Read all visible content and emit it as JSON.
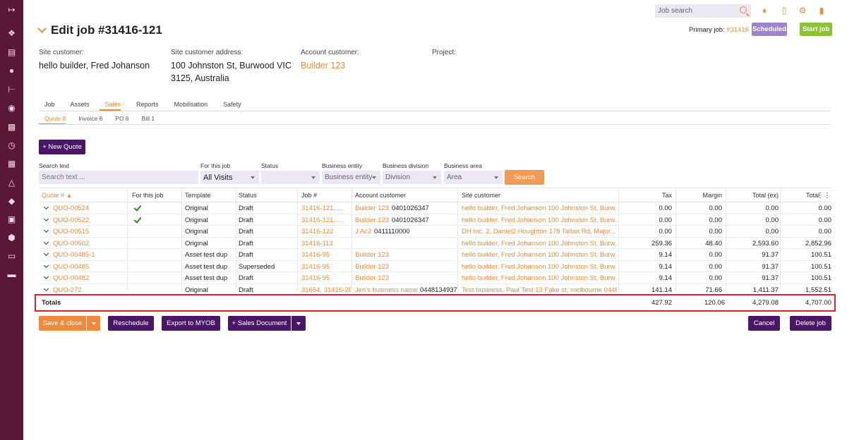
{
  "sidebar": {
    "icons": [
      "expand-icon",
      "tags-icon",
      "document-icon",
      "person-icon",
      "hierarchy-icon",
      "location-pin-icon",
      "chart-icon",
      "clock-icon",
      "calendar-icon",
      "cube-icon",
      "tag-icon",
      "list-box-icon",
      "shield-icon",
      "book-icon",
      "inbox-icon"
    ]
  },
  "topbar": {
    "search_placeholder": "Job search"
  },
  "header": {
    "title": "Edit job #31416-121",
    "primary_job_label": "Primary job:",
    "primary_job_value": "#31416",
    "status_badge": "Scheduled",
    "start_button": "Start job"
  },
  "info": {
    "site_customer_label": "Site customer:",
    "site_customer_value": "hello builder, Fred Johanson",
    "site_address_label": "Site customer address:",
    "site_address_line1": "100 Johnston St, Burwood VIC",
    "site_address_line2": "3125, Australia",
    "account_customer_label": "Account customer:",
    "account_customer_value": "Builder 123",
    "project_label": "Project:"
  },
  "tabs": [
    "Job",
    "Assets",
    "Sales",
    "Reports",
    "Mobilisation",
    "Safety"
  ],
  "active_tab": "Sales",
  "subtabs": [
    "Quote 8",
    "Invoice 6",
    "PO 6",
    "Bill 1"
  ],
  "new_quote_button": "+ New Quote",
  "filters": {
    "search_text_label": "Search text",
    "search_text_placeholder": "Search text ...",
    "for_this_job_label": "For this job",
    "for_this_job_value": "All Visits",
    "status_label": "Status",
    "status_value": "",
    "business_entity_label": "Business entity",
    "business_entity_value": "Business entity",
    "business_division_label": "Business division",
    "business_division_value": "Division",
    "business_area_label": "Business area",
    "business_area_value": "Area",
    "search_button": "Search"
  },
  "table": {
    "columns": [
      "Quote #",
      "For this job",
      "Template",
      "Status",
      "Job #",
      "Account customer",
      "Site customer",
      "Tax",
      "Margin",
      "Total (ex)",
      "Total"
    ],
    "rows": [
      {
        "quote": "QUO-00524",
        "for_job": true,
        "template": "Original",
        "status": "Draft",
        "job": "31416-121, ...",
        "account": "Builder 123",
        "account_phone": "0401026347",
        "site": "hello builder, Fred Johanson 100 Johnston St, Burw...",
        "tax": "0.00",
        "margin": "0.00",
        "total_ex": "0.00",
        "total": "0.00"
      },
      {
        "quote": "QUO-00522",
        "for_job": true,
        "template": "Original",
        "status": "Draft",
        "job": "31416-121, ...",
        "account": "Builder 123",
        "account_phone": "0401026347",
        "site": "hello builder, Fred Johanson 100 Johnston St, Burw...",
        "tax": "0.00",
        "margin": "0.00",
        "total_ex": "0.00",
        "total": "0.00"
      },
      {
        "quote": "QUO-00515",
        "for_job": false,
        "template": "Original",
        "status": "Draft",
        "job": "31416-122",
        "account": "J Ac2",
        "account_phone": "0411110000",
        "site": "DH Inc. 2, Daniel2 Houghton 178 Talbot Rd, Major...",
        "tax": "0.00",
        "margin": "0.00",
        "total_ex": "0.00",
        "total": "0.00"
      },
      {
        "quote": "QUO-00502",
        "for_job": false,
        "template": "Original",
        "status": "Draft",
        "job": "31416-113",
        "account": "",
        "account_phone": "",
        "site": "hello builder, Fred Johanson 100 Johnston St, Burw...",
        "tax": "259.36",
        "margin": "48.40",
        "total_ex": "2,593.60",
        "total": "2,852.96"
      },
      {
        "quote": "QUO-00485-1",
        "for_job": false,
        "template": "Asset test dup",
        "status": "Draft",
        "job": "31416-95",
        "account": "Builder 123",
        "account_phone": "",
        "site": "hello builder, Fred Johanson 100 Johnston St, Burw...",
        "tax": "9.14",
        "margin": "0.00",
        "total_ex": "91.37",
        "total": "100.51"
      },
      {
        "quote": "QUO-00485",
        "for_job": false,
        "template": "Asset test dup",
        "status": "Superseded",
        "job": "31416-95",
        "account": "Builder 123",
        "account_phone": "",
        "site": "hello builder, Fred Johanson 100 Johnston St, Burw...",
        "tax": "9.14",
        "margin": "0.00",
        "total_ex": "91.37",
        "total": "100.51"
      },
      {
        "quote": "QUO-00482",
        "for_job": false,
        "template": "Asset test dup",
        "status": "Draft",
        "job": "31416-95",
        "account": "Builder 123",
        "account_phone": "",
        "site": "hello builder, Fred Johanson 100 Johnston St, Burw...",
        "tax": "9.14",
        "margin": "0.00",
        "total_ex": "91.37",
        "total": "100.51"
      },
      {
        "quote": "QUO-272",
        "for_job": false,
        "template": "Original",
        "status": "Draft",
        "job": "31664, 31416-28",
        "account": "Jen's business name",
        "account_phone": "0448134937",
        "site": "Test business, Paul Test 13 Fake st, melbourne 0448...",
        "tax": "141.14",
        "margin": "71.66",
        "total_ex": "1,411.37",
        "total": "1,552.51"
      }
    ],
    "totals_label": "Totals",
    "totals": {
      "tax": "427.92",
      "margin": "120.06",
      "total_ex": "4,279.08",
      "total": "4,707.00"
    }
  },
  "footer": {
    "save_close": "Save & close",
    "reschedule": "Reschedule",
    "export_myob": "Export to MYOB",
    "sales_document": "+ Sales Document",
    "cancel": "Cancel",
    "delete_job": "Delete job"
  },
  "colors": {
    "sidebar": "#5b1736",
    "accent": "#ef8a3c",
    "primary": "#4a1766",
    "scheduled": "#9d85c9",
    "start": "#8bc23a",
    "highlight": "#e0202c"
  }
}
